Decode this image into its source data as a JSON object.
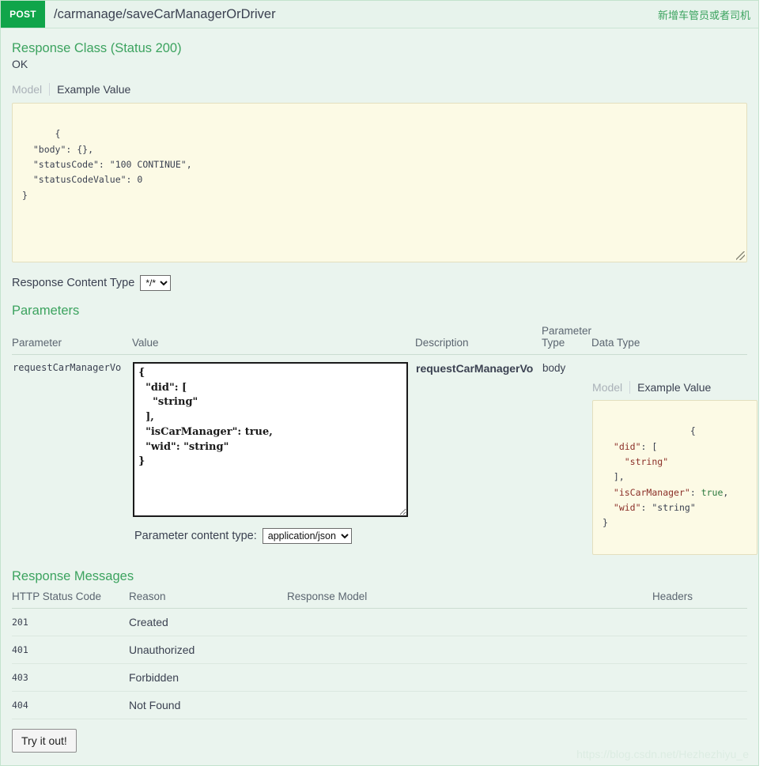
{
  "operation": {
    "method": "POST",
    "path": "/carmanage/saveCarManagerOrDriver",
    "summary": "新增车管员或者司机",
    "method_color": "#10a54a",
    "accent_color": "#3ca35f"
  },
  "response_class": {
    "title": "Response Class (Status 200)",
    "status_text": "OK",
    "tabs": {
      "model": "Model",
      "example": "Example Value"
    },
    "example_value": "{\n  \"body\": {},\n  \"statusCode\": \"100 CONTINUE\",\n  \"statusCodeValue\": 0\n}"
  },
  "response_content_type": {
    "label": "Response Content Type",
    "selected": "*/*",
    "options": [
      "*/*"
    ]
  },
  "parameters": {
    "title": "Parameters",
    "headers": {
      "parameter": "Parameter",
      "value": "Value",
      "description": "Description",
      "parameter_type": "Parameter Type",
      "data_type": "Data Type"
    },
    "rows": [
      {
        "name": "requestCarManagerVo",
        "value": "{\n  \"did\": [\n    \"string\"\n  ],\n  \"isCarManager\": true,\n  \"wid\": \"string\"\n}",
        "description": "requestCarManagerVo",
        "parameter_type": "body",
        "data_type_tabs": {
          "model": "Model",
          "example": "Example Value"
        }
      }
    ],
    "content_type": {
      "label": "Parameter content type:",
      "selected": "application/json",
      "options": [
        "application/json"
      ]
    }
  },
  "response_messages": {
    "title": "Response Messages",
    "headers": {
      "status_code": "HTTP Status Code",
      "reason": "Reason",
      "response_model": "Response Model",
      "headers": "Headers"
    },
    "rows": [
      {
        "code": "201",
        "reason": "Created",
        "model": "",
        "headers": ""
      },
      {
        "code": "401",
        "reason": "Unauthorized",
        "model": "",
        "headers": ""
      },
      {
        "code": "403",
        "reason": "Forbidden",
        "model": "",
        "headers": ""
      },
      {
        "code": "404",
        "reason": "Not Found",
        "model": "",
        "headers": ""
      }
    ]
  },
  "try_button": {
    "label": "Try it out!"
  },
  "watermark": {
    "text": "https://blog.csdn.net/Hezhezhiyu_e"
  }
}
